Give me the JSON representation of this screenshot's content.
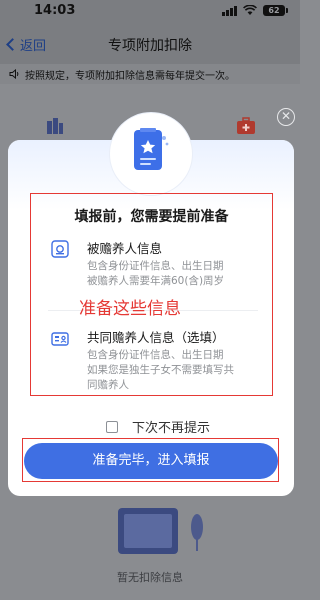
{
  "status_bar": {
    "time": "14:03",
    "battery": "62",
    "wifi_icon": "wifi-icon",
    "signal_icon": "signal-icon"
  },
  "navbar": {
    "back_label": "返回",
    "title": "专项附加扣除"
  },
  "notice": {
    "text": "按照规定，专项附加扣除信息需每年提交一次。",
    "icon": "speaker-icon"
  },
  "background": {
    "empty_text": "暂无扣除信息"
  },
  "dialog": {
    "title": "填报前，您需要提前准备",
    "items": [
      {
        "icon": "id-card-icon",
        "title": "被赡养人信息",
        "desc_lines": [
          "包含身份证件信息、出生日期",
          "被赡养人需要年满60(含)周岁"
        ]
      },
      {
        "icon": "shared-info-icon",
        "title": "共同赡养人信息（选填）",
        "desc_lines": [
          "包含身份证件信息、出生日期",
          "如果您是独生子女不需要填写共",
          "同赡养人"
        ]
      }
    ],
    "annotation": "准备这些信息",
    "checkbox_label": "下次不再提示",
    "confirm_label": "准备完毕，进入填报"
  },
  "colors": {
    "accent": "#3f6fe3",
    "annotation": "#e53935",
    "back_link": "#1e3f86"
  }
}
